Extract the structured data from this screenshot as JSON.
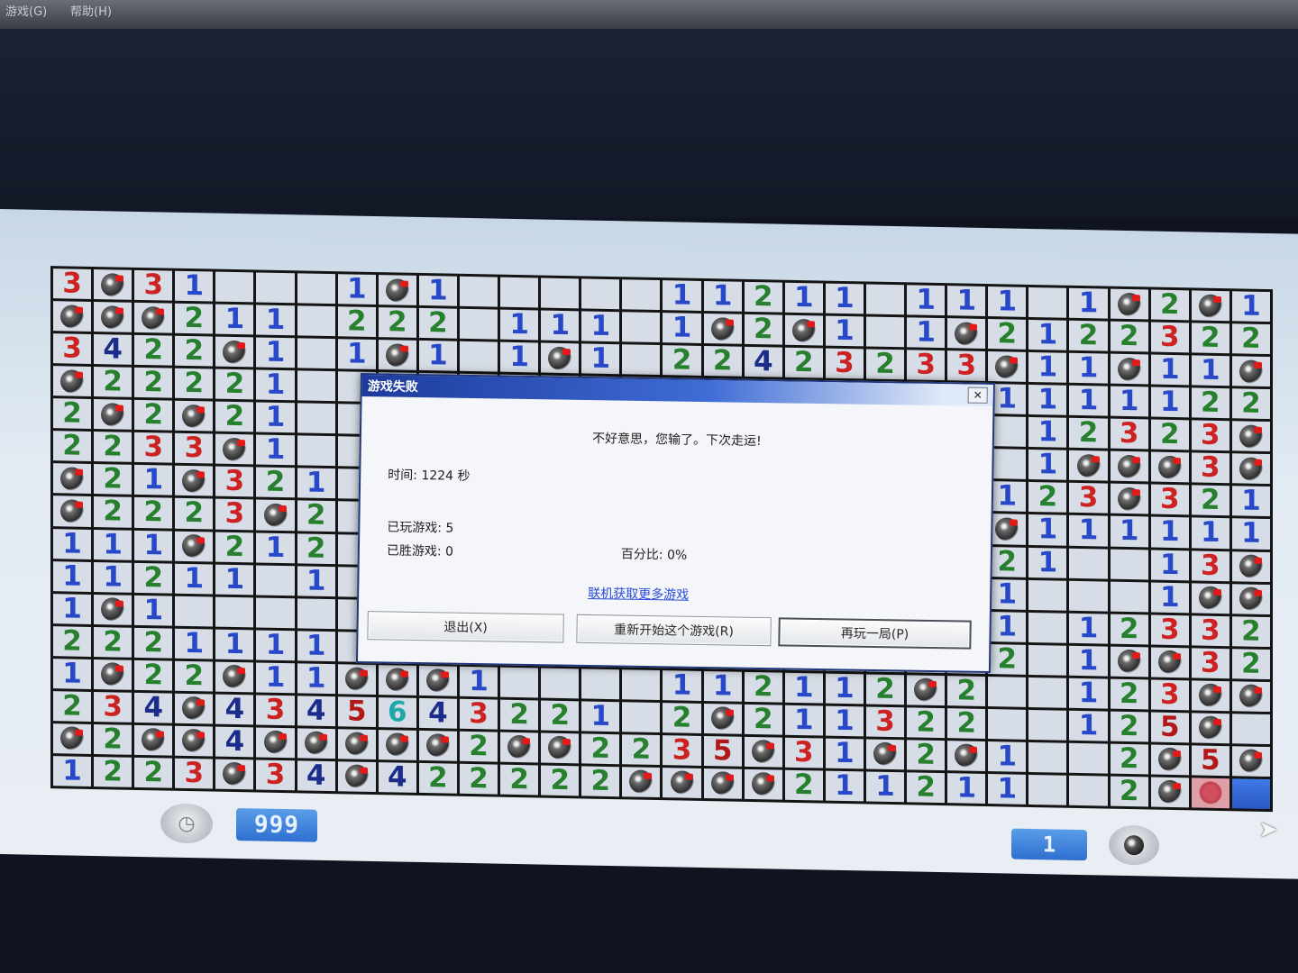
{
  "menubar": {
    "item1": "游戏(G)",
    "item2": "帮助(H)"
  },
  "status": {
    "timer_value": "999",
    "mines_remaining": "1"
  },
  "board": {
    "rows": [
      [
        "3",
        "B",
        "3",
        "1",
        "",
        "",
        "",
        "1",
        "B",
        "1",
        "",
        "",
        "",
        "",
        "",
        "1",
        "1",
        "2",
        "1",
        "1",
        "",
        "1",
        "1",
        "1",
        "",
        "1",
        "B",
        "2",
        "B",
        "1"
      ],
      [
        "B",
        "B",
        "B",
        "2",
        "1",
        "1",
        "",
        "2",
        "2",
        "2",
        "",
        "1",
        "1",
        "1",
        "",
        "1",
        "B",
        "2",
        "B",
        "1",
        "",
        "1",
        "B",
        "2",
        "1",
        "2",
        "2",
        "3",
        "2",
        "2"
      ],
      [
        "3",
        "4",
        "2",
        "2",
        "B",
        "1",
        "",
        "1",
        "B",
        "1",
        "",
        "1",
        "B",
        "1",
        "",
        "2",
        "2",
        "4",
        "2",
        "3",
        "2",
        "3",
        "3",
        "B",
        "1",
        "1",
        "B",
        "1",
        "1",
        "B"
      ],
      [
        "B",
        "2",
        "2",
        "2",
        "2",
        "1",
        "",
        "",
        "",
        "",
        "",
        "",
        "",
        "",
        "",
        "",
        "",
        "",
        "",
        "",
        "",
        "",
        "",
        "1",
        "1",
        "1",
        "1",
        "1",
        "2",
        "2"
      ],
      [
        "2",
        "B",
        "2",
        "B",
        "2",
        "1",
        "",
        "",
        "",
        "",
        "",
        "",
        "",
        "",
        "",
        "",
        "",
        "",
        "",
        "",
        "",
        "",
        "",
        "",
        "1",
        "2",
        "3",
        "2",
        "3",
        "B"
      ],
      [
        "2",
        "2",
        "3",
        "3",
        "B",
        "1",
        "",
        "",
        "",
        "",
        "",
        "",
        "",
        "",
        "",
        "",
        "",
        "",
        "",
        "",
        "",
        "",
        "",
        "",
        "1",
        "B",
        "B",
        "B",
        "3",
        "B"
      ],
      [
        "B",
        "2",
        "1",
        "B",
        "3",
        "2",
        "1",
        "",
        "",
        "",
        "",
        "",
        "",
        "",
        "",
        "",
        "",
        "",
        "",
        "",
        "",
        "",
        "",
        "1",
        "2",
        "3",
        "B",
        "3",
        "2",
        "1"
      ],
      [
        "B",
        "2",
        "2",
        "2",
        "3",
        "B",
        "2",
        "",
        "",
        "",
        "",
        "",
        "",
        "",
        "",
        "",
        "",
        "",
        "",
        "",
        "",
        "",
        "",
        "B",
        "1",
        "1",
        "1",
        "1",
        "1",
        "1"
      ],
      [
        "1",
        "1",
        "1",
        "B",
        "2",
        "1",
        "2",
        "",
        "",
        "",
        "",
        "",
        "",
        "",
        "",
        "",
        "",
        "",
        "",
        "",
        "",
        "",
        "",
        "2",
        "1",
        "",
        "",
        "1",
        "3",
        "B"
      ],
      [
        "1",
        "1",
        "2",
        "1",
        "1",
        "",
        "1",
        "",
        "",
        "",
        "",
        "",
        "",
        "",
        "",
        "",
        "",
        "",
        "",
        "",
        "",
        "",
        "",
        "1",
        "",
        "",
        "",
        "1",
        "B",
        "B"
      ],
      [
        "1",
        "B",
        "1",
        "",
        "",
        "",
        "",
        "",
        "",
        "",
        "",
        "",
        "",
        "",
        "",
        "",
        "",
        "",
        "",
        "",
        "",
        "",
        "",
        "1",
        "",
        "1",
        "2",
        "3",
        "3",
        "2"
      ],
      [
        "2",
        "2",
        "2",
        "1",
        "1",
        "1",
        "1",
        "",
        "",
        "",
        "",
        "",
        "",
        "",
        "",
        "",
        "",
        "",
        "",
        "",
        "",
        "",
        "",
        "2",
        "",
        "1",
        "B",
        "B",
        "3",
        "2"
      ],
      [
        "1",
        "B",
        "2",
        "2",
        "B",
        "1",
        "1",
        "B",
        "B",
        "B",
        "1",
        "",
        "",
        "",
        "",
        "1",
        "1",
        "2",
        "1",
        "1",
        "2",
        "B",
        "2",
        "",
        "",
        "1",
        "2",
        "3",
        "B",
        "B"
      ],
      [
        "2",
        "3",
        "4",
        "B",
        "4",
        "3",
        "4",
        "5",
        "6",
        "4",
        "3",
        "2",
        "2",
        "1",
        "",
        "2",
        "B",
        "2",
        "1",
        "1",
        "3",
        "2",
        "2",
        "",
        "",
        "1",
        "2",
        "5",
        "B"
      ],
      [
        "B",
        "2",
        "B",
        "B",
        "4",
        "B",
        "B",
        "B",
        "B",
        "B",
        "2",
        "B",
        "B",
        "2",
        "2",
        "3",
        "5",
        "B",
        "3",
        "1",
        "B",
        "2",
        "B",
        "1",
        "",
        "",
        "2",
        "B",
        "5",
        "B"
      ],
      [
        "1",
        "2",
        "2",
        "3",
        "B",
        "3",
        "4",
        "B",
        "4",
        "2",
        "2",
        "2",
        "2",
        "2",
        "B",
        "B",
        "B",
        "B",
        "2",
        "1",
        "1",
        "2",
        "1",
        "1",
        "",
        "",
        "2",
        "B",
        "R",
        "U"
      ]
    ]
  },
  "dialog": {
    "title": "游戏失败",
    "close": "✕",
    "message": "不好意思，您输了。下次走运!",
    "time": "时间: 1224 秒",
    "games_played": "已玩游戏: 5",
    "games_won": "已胜游戏: 0",
    "percent": "百分比: 0%",
    "link": "联机获取更多游戏",
    "buttons": {
      "exit": "退出(X)",
      "restart": "重新开始这个游戏(R)",
      "play_again": "再玩一局(P)"
    }
  },
  "icons": {
    "timer": "clock-icon",
    "mine_counter": "mine-icon",
    "cursor": "mouse-pointer-icon"
  }
}
